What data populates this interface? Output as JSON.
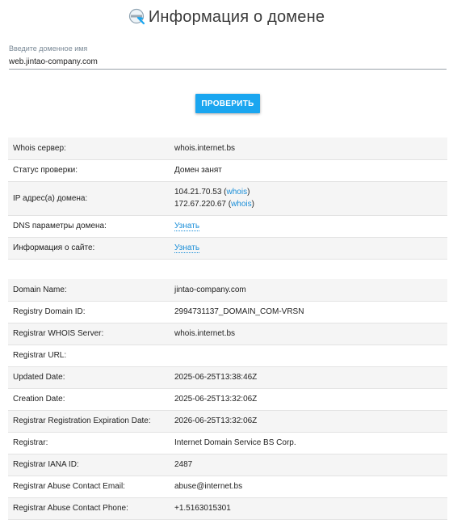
{
  "header": {
    "title": "Информация о домене",
    "icon": "magnifier-globe-icon"
  },
  "search": {
    "label": "Введите доменное имя",
    "value": "web.jintao-company.com",
    "button_label": "ПРОВЕРИТЬ"
  },
  "summary": {
    "whois_server_label": "Whois сервер:",
    "whois_server_value": "whois.internet.bs",
    "status_label": "Статус проверки:",
    "status_value": "Домен занят",
    "ip_label": "IP адрес(а) домена:",
    "ips": [
      {
        "ip": "104.21.70.53",
        "link": "whois"
      },
      {
        "ip": "172.67.220.67",
        "link": "whois"
      }
    ],
    "dns_label": "DNS параметры домена:",
    "dns_link": "Узнать",
    "site_label": "Информация о сайте:",
    "site_link": "Узнать"
  },
  "whois_rows": [
    {
      "key": "Domain Name:",
      "value": "jintao-company.com"
    },
    {
      "key": "Registry Domain ID:",
      "value": "2994731137_DOMAIN_COM-VRSN"
    },
    {
      "key": "Registrar WHOIS Server:",
      "value": "whois.internet.bs"
    },
    {
      "key": "Registrar URL:",
      "value": ""
    },
    {
      "key": "Updated Date:",
      "value": "2025-06-25T13:38:46Z"
    },
    {
      "key": "Creation Date:",
      "value": "2025-06-25T13:32:06Z"
    },
    {
      "key": "Registrar Registration Expiration Date:",
      "value": "2026-06-25T13:32:06Z"
    },
    {
      "key": "Registrar:",
      "value": "Internet Domain Service BS Corp."
    },
    {
      "key": "Registrar IANA ID:",
      "value": "2487"
    },
    {
      "key": "Registrar Abuse Contact Email:",
      "value": "abuse@internet.bs"
    },
    {
      "key": "Registrar Abuse Contact Phone:",
      "value": "+1.5163015301"
    }
  ],
  "colors": {
    "accent": "#1aa6f0",
    "link": "#1a8ed8",
    "row_alt": "#f5f5f5"
  }
}
